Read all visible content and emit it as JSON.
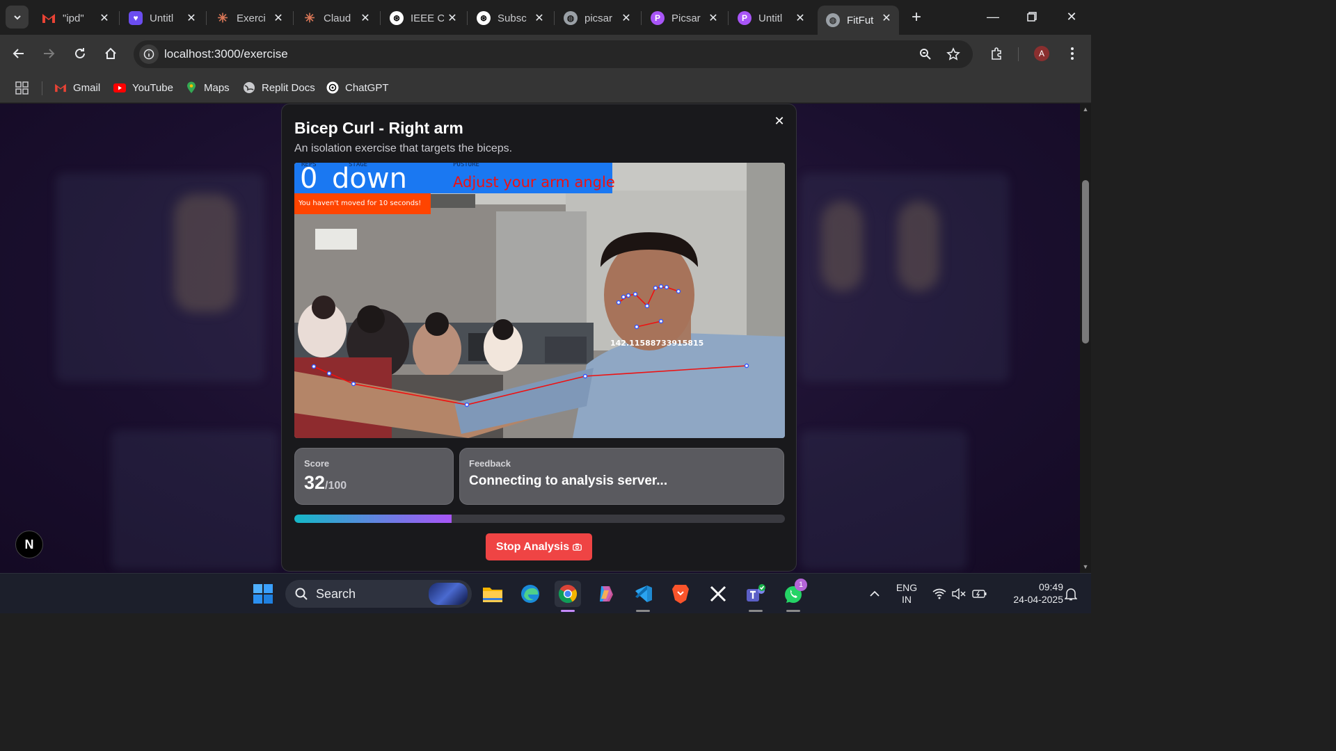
{
  "browser": {
    "tabs": [
      {
        "label": "\"ipd\"",
        "icon": "gmail-icon",
        "color": "#ea4335"
      },
      {
        "label": "Untitl",
        "icon": "heart-icon",
        "color": "#7c5cff"
      },
      {
        "label": "Exerci",
        "icon": "claude-icon",
        "color": "#d97757"
      },
      {
        "label": "Claud",
        "icon": "claude-icon",
        "color": "#d97757"
      },
      {
        "label": "IEEE C",
        "icon": "openai-icon",
        "color": "#ffffff"
      },
      {
        "label": "Subsc",
        "icon": "openai-icon",
        "color": "#ffffff"
      },
      {
        "label": "picsar",
        "icon": "globe-icon",
        "color": "#9aa0a6"
      },
      {
        "label": "Picsar",
        "icon": "picsart-icon",
        "color": "#a855f7"
      },
      {
        "label": "Untitl",
        "icon": "picsart-icon",
        "color": "#a855f7"
      },
      {
        "label": "FitFut",
        "icon": "globe-icon",
        "color": "#9aa0a6"
      }
    ],
    "url": "localhost:3000/exercise",
    "profile_initial": "A",
    "bookmarks": [
      {
        "label": "Gmail",
        "icon": "gmail-icon"
      },
      {
        "label": "YouTube",
        "icon": "youtube-icon"
      },
      {
        "label": "Maps",
        "icon": "maps-icon"
      },
      {
        "label": "Replit Docs",
        "icon": "globe-icon"
      },
      {
        "label": "ChatGPT",
        "icon": "openai-icon"
      }
    ]
  },
  "page": {
    "side_badge": "N",
    "modal": {
      "title": "Bicep Curl - Right arm",
      "description": "An isolation exercise that targets the biceps.",
      "video_overlay": {
        "reps_label": "REPS",
        "stage_label": "STAGE",
        "posture_label": "POSTURE",
        "reps": "0",
        "stage": "down",
        "posture": "Adjust your arm angle",
        "warning": "You haven't moved for 10 seconds!",
        "angle": "142.11588733915815"
      },
      "score": {
        "label": "Score",
        "value": "32",
        "max": "/100"
      },
      "feedback": {
        "label": "Feedback",
        "text": "Connecting to analysis server..."
      },
      "progress": 0.32,
      "stop_button": "Stop Analysis"
    }
  },
  "taskbar": {
    "search": "Search",
    "apps": [
      "start-icon",
      "file-explorer-icon",
      "edge-icon",
      "chrome-icon",
      "copilot-icon",
      "vscode-icon",
      "brave-icon",
      "x-icon",
      "teams-icon",
      "whatsapp-icon"
    ],
    "whatsapp_badge": "1",
    "lang_top": "ENG",
    "lang_bottom": "IN",
    "time": "09:49",
    "date": "24-04-2025"
  }
}
